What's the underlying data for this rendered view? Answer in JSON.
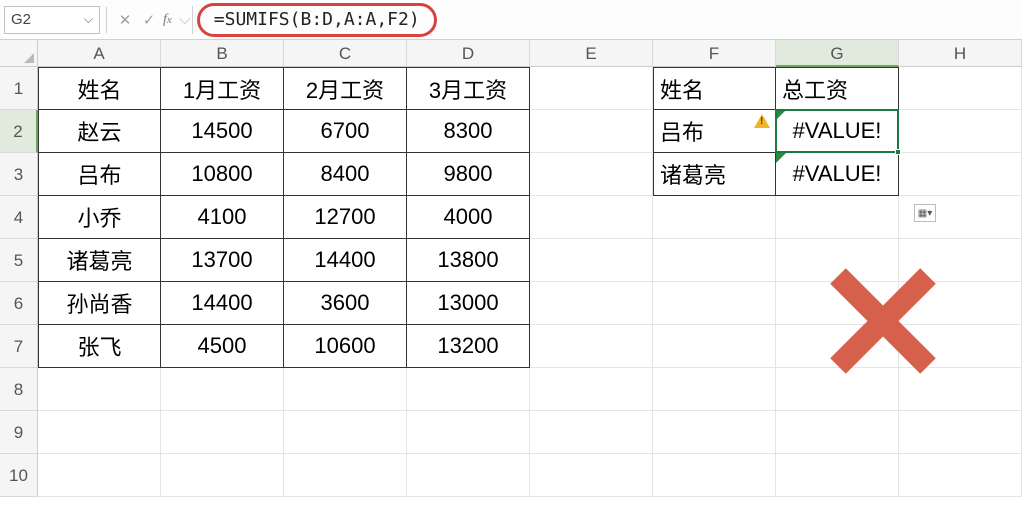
{
  "formula_bar": {
    "name_box": "G2",
    "formula": "=SUMIFS(B:D,A:A,F2)"
  },
  "columns": [
    "A",
    "B",
    "C",
    "D",
    "E",
    "F",
    "G",
    "H"
  ],
  "rows": [
    "1",
    "2",
    "3",
    "4",
    "5",
    "6",
    "7",
    "8",
    "9",
    "10"
  ],
  "selected_col_index": 6,
  "selected_row_index": 1,
  "table_main": {
    "header": [
      "姓名",
      "1月工资",
      "2月工资",
      "3月工资"
    ],
    "rows": [
      [
        "赵云",
        "14500",
        "6700",
        "8300"
      ],
      [
        "吕布",
        "10800",
        "8400",
        "9800"
      ],
      [
        "小乔",
        "4100",
        "12700",
        "4000"
      ],
      [
        "诸葛亮",
        "13700",
        "14400",
        "13800"
      ],
      [
        "孙尚香",
        "14400",
        "3600",
        "13000"
      ],
      [
        "张飞",
        "4500",
        "10600",
        "13200"
      ]
    ]
  },
  "table_side": {
    "header": [
      "姓名",
      "总工资"
    ],
    "rows": [
      [
        "吕布",
        "#VALUE!"
      ],
      [
        "诸葛亮",
        "#VALUE!"
      ]
    ]
  },
  "overlay": {
    "x_mark": true
  }
}
